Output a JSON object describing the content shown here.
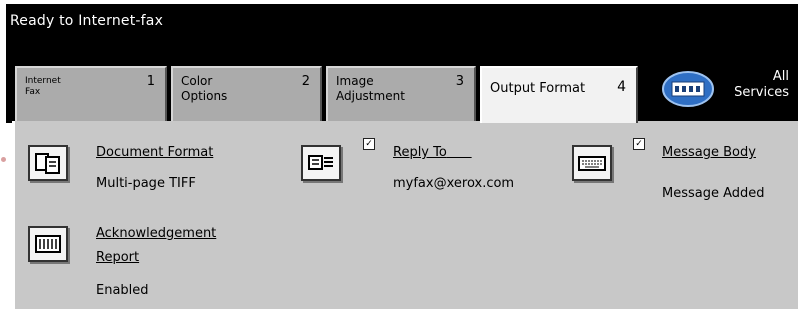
{
  "status_text": "Ready to Internet-fax",
  "tabs": [
    {
      "name": "Internet Fax",
      "number": "1"
    },
    {
      "name": "Color Options",
      "number": "2"
    },
    {
      "name": "Image Adjustment",
      "number": "3"
    },
    {
      "name": "Output Format",
      "number": "4"
    }
  ],
  "all_services": {
    "label": "All Services",
    "icon": "keypad-icon"
  },
  "options": {
    "document_format": {
      "label": "Document Format",
      "value": "Multi-page TIFF",
      "icon": "document-format-icon"
    },
    "reply_to": {
      "label": "Reply To",
      "value": "myfax@xerox.com",
      "icon": "reply-to-icon",
      "checked": "✓"
    },
    "message_body": {
      "label": "Message Body",
      "value": "Message Added",
      "icon": "keyboard-icon",
      "checked": "✓"
    },
    "acknowledgement_report": {
      "label_line1": "Acknowledgement",
      "label_line2": "Report",
      "value": "Enabled",
      "icon": "report-icon"
    }
  }
}
